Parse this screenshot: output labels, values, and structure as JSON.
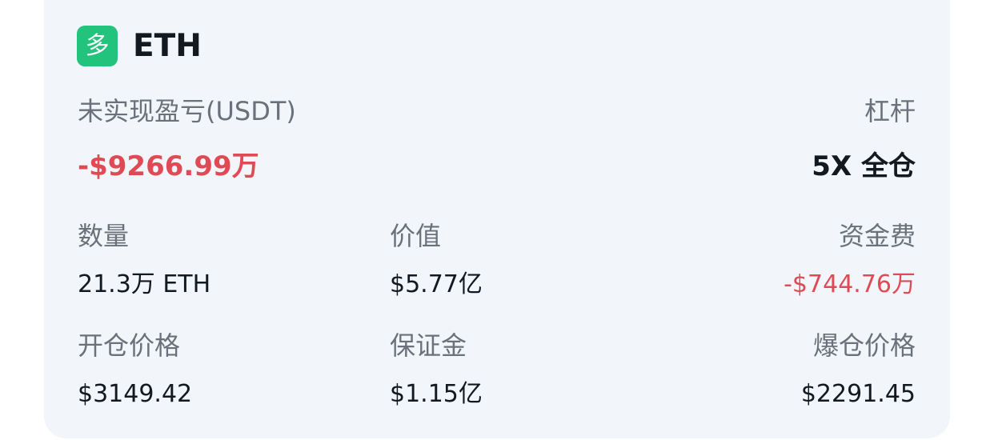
{
  "position": {
    "side_badge": "多",
    "symbol": "ETH",
    "colors": {
      "long": "#22c47d",
      "negative": "#e04a55",
      "text": "#14181f",
      "muted": "#6b717a",
      "card": "#f2f5f9"
    },
    "unrealized_pnl": {
      "label": "未实现盈亏(USDT)",
      "value": "-$9266.99万"
    },
    "leverage": {
      "label": "杠杆",
      "value": "5X 全仓"
    },
    "quantity": {
      "label": "数量",
      "value": "21.3万 ETH"
    },
    "value": {
      "label": "价值",
      "value": "$5.77亿"
    },
    "funding_fee": {
      "label": "资金费",
      "value": "-$744.76万"
    },
    "entry_price": {
      "label": "开仓价格",
      "value": "$3149.42"
    },
    "margin": {
      "label": "保证金",
      "value": "$1.15亿"
    },
    "liquidation_price": {
      "label": "爆仓价格",
      "value": "$2291.45"
    }
  }
}
